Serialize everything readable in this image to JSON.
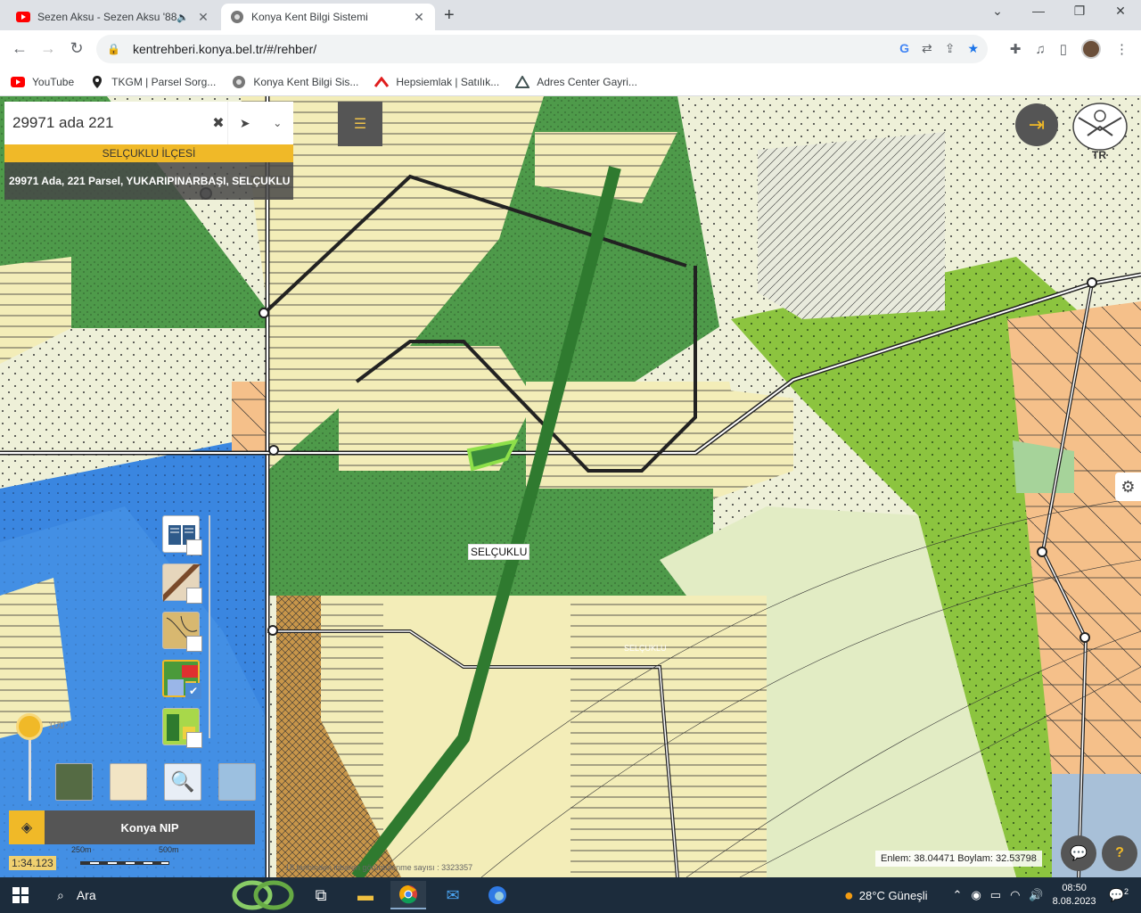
{
  "browser": {
    "tabs": [
      {
        "title": "Sezen Aksu - Sezen Aksu '88",
        "active": false,
        "audio": "speaker-icon"
      },
      {
        "title": "Konya Kent Bilgi Sistemi",
        "active": true
      }
    ],
    "url": "kentrehberi.konya.bel.tr/#/rehber/",
    "bookmarks": [
      {
        "label": "YouTube",
        "icon": "youtube-icon"
      },
      {
        "label": "TKGM | Parsel Sorg...",
        "icon": "location-pin-icon"
      },
      {
        "label": "Konya Kent Bilgi Sis...",
        "icon": "konya-icon"
      },
      {
        "label": "Hepsiemlak | Satılık...",
        "icon": "hepsiemlak-icon"
      },
      {
        "label": "Adres Center Gayri...",
        "icon": "adres-center-icon"
      }
    ]
  },
  "search": {
    "value": "29971 ada 221",
    "district": "SELÇUKLU İLÇESİ",
    "result": "29971 Ada, 221 Parsel, YUKARIPINARBAŞI, SELÇUKLU"
  },
  "map": {
    "region_label": "SELÇUKLU",
    "faint_labels": [
      "SELÇUKLU"
    ],
    "scale_ratio": "1:34.123",
    "scalebar_labels": [
      "250m",
      "500m"
    ],
    "opacity_value": "100",
    "coords": "Enlem: 38.04471 Boylam: 32.53798",
    "emblem_text": "TR",
    "bottom_text": "18 tarihinden itibaren görüntülenme sayısı : 3323357"
  },
  "layers": {
    "items": [
      {
        "name": "book-layer",
        "checked": false
      },
      {
        "name": "parcel-layer",
        "checked": false
      },
      {
        "name": "zoning-layer",
        "checked": false
      },
      {
        "name": "plan-layer",
        "checked": true
      },
      {
        "name": "green-layer",
        "checked": false
      }
    ],
    "panel_label": "Konya NIP"
  },
  "taskbar": {
    "search_placeholder": "Ara",
    "weather": "28°C  Güneşli",
    "time": "08:50",
    "date": "8.08.2023",
    "notifications": "2"
  },
  "colors": {
    "yellow_accent": "#f0b928",
    "dark_panel": "#555555",
    "forest_green": "#4e9a4a",
    "light_green": "#8cc43f",
    "residential": "#f3edb8",
    "water_blue": "#3a86e0",
    "orange_zone": "#f5c08a"
  }
}
